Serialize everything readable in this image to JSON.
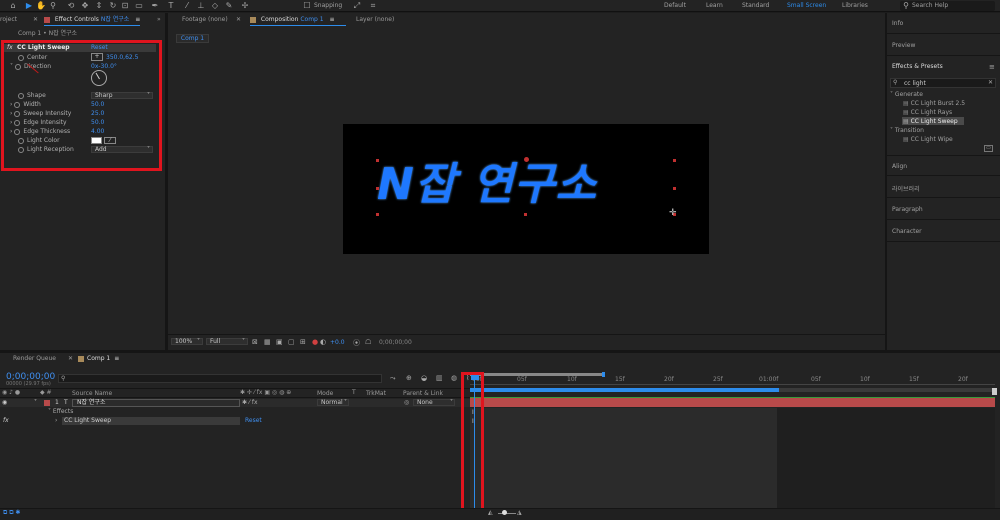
{
  "toolbar": {
    "snapping": "Snapping",
    "workspaces": [
      "Default",
      "Learn",
      "Standard",
      "Small Screen",
      "Libraries"
    ],
    "active_workspace": "Small Screen",
    "search_placeholder": "Search Help"
  },
  "effect_controls": {
    "tab_project": "roject",
    "tab_label": "Effect Controls",
    "tab_layer": "N잡 연구소",
    "breadcrumb": "Comp 1 • N잡 연구소",
    "effect_name": "CC Light Sweep",
    "reset": "Reset",
    "params": [
      {
        "label": "Center",
        "value": "350.0,62.5"
      },
      {
        "label": "Direction",
        "value": "0x-30.0°"
      },
      {
        "label": "Shape",
        "value": "Sharp"
      },
      {
        "label": "Width",
        "value": "50.0"
      },
      {
        "label": "Sweep Intensity",
        "value": "25.0"
      },
      {
        "label": "Edge Intensity",
        "value": "50.0"
      },
      {
        "label": "Edge Thickness",
        "value": "4.00"
      },
      {
        "label": "Light Color",
        "value": ""
      },
      {
        "label": "Light Reception",
        "value": "Add"
      }
    ]
  },
  "viewer": {
    "tab_footage": "Footage (none)",
    "tab_composition": "Composition",
    "comp_name": "Comp 1",
    "tab_layer": "Layer (none)",
    "breadcrumb": "Comp 1",
    "canvas_text": "N잡 연구소",
    "zoom": "100%",
    "resolution": "Full",
    "exposure": "+0.0",
    "timecode": "0;00;00;00"
  },
  "right_panel": {
    "info": "Info",
    "preview": "Preview",
    "effects_presets": "Effects & Presets",
    "search_value": "cc light",
    "generate": "Generate",
    "generate_items": [
      "CC Light Burst 2.5",
      "CC Light Rays",
      "CC Light Sweep"
    ],
    "transition": "Transition",
    "transition_items": [
      "CC Light Wipe"
    ],
    "align": "Align",
    "library": "라이브러리",
    "paragraph": "Paragraph",
    "character": "Character"
  },
  "timeline": {
    "tab_render": "Render Queue",
    "tab_comp": "Comp 1",
    "timecode": "0;00;00;00",
    "fps": "00000 (29.97 fps)",
    "col_source": "Source Name",
    "col_mode": "Mode",
    "col_trkmat": "TrkMat",
    "col_parent": "Parent & Link",
    "layer_num": "1",
    "layer_name": "N잡 연구소",
    "layer_mode": "Normal",
    "layer_parent": "None",
    "effects_label": "Effects",
    "effect_name": "CC Light Sweep",
    "effect_reset": "Reset",
    "ruler": [
      "00f",
      "05f",
      "10f",
      "15f",
      "20f",
      "25f",
      "01:00f",
      "05f",
      "10f",
      "15f",
      "20f"
    ]
  },
  "colors": {
    "accent": "#2d8ceb",
    "highlight": "#e0141e",
    "layer_bar": "#b84a4a",
    "canvas_text": "#1e78ff"
  }
}
